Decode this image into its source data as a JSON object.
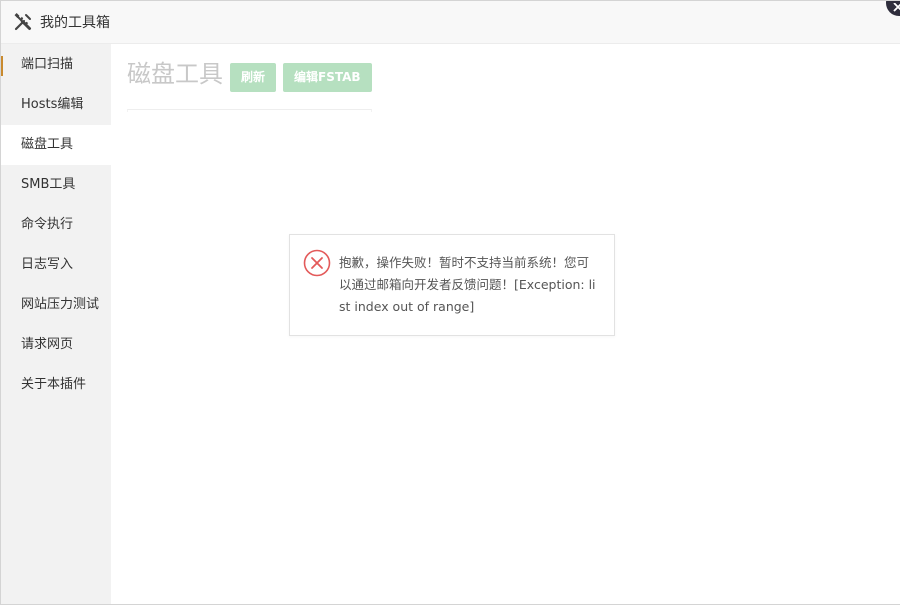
{
  "window": {
    "title": "我的工具箱",
    "title_icon": "tools-icon",
    "close_icon": "close-icon"
  },
  "sidebar": {
    "items": [
      {
        "label": "端口扫描",
        "active": false
      },
      {
        "label": "Hosts编辑",
        "active": false
      },
      {
        "label": "磁盘工具",
        "active": true
      },
      {
        "label": "SMB工具",
        "active": false
      },
      {
        "label": "命令执行",
        "active": false
      },
      {
        "label": "日志写入",
        "active": false
      },
      {
        "label": "网站压力测试",
        "active": false
      },
      {
        "label": "请求网页",
        "active": false
      },
      {
        "label": "关于本插件",
        "active": false
      }
    ]
  },
  "main": {
    "title": "磁盘工具",
    "refresh_label": "刷新",
    "edit_fstab_label": "编辑FSTAB"
  },
  "dialog": {
    "icon": "error-icon",
    "message": "抱歉，操作失败！暂时不支持当前系统！您可以通过邮箱向开发者反馈问题！[Exception: list index out of range]"
  },
  "colors": {
    "button_bg": "#b6e0c0",
    "sidebar_bg": "#f2f2f2",
    "error_red": "#e35a5a",
    "title_gray": "#c8c8c8"
  }
}
